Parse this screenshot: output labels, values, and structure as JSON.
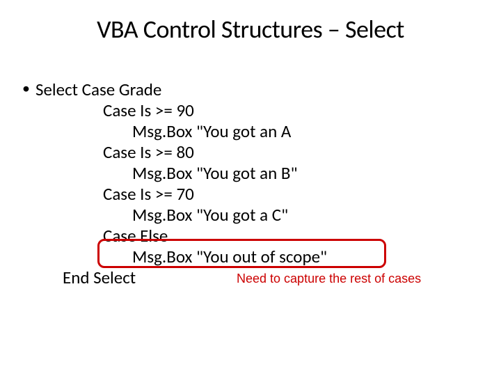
{
  "title": "VBA Control Structures – Select",
  "code": {
    "line0": "Select Case Grade",
    "case1": "Case Is >= 90",
    "msg1": "Msg.Box \"You got an A",
    "case2": "Case Is >= 80",
    "msg2": "Msg.Box \"You got an B\"",
    "case3": "Case Is >= 70",
    "msg3": "Msg.Box \"You got a C\"",
    "case4": "Case Else",
    "msg4": "Msg.Box \"You out of scope\"",
    "end": "End Select"
  },
  "annotation": "Need to capture the rest of cases",
  "colors": {
    "highlight": "#cc0000"
  }
}
